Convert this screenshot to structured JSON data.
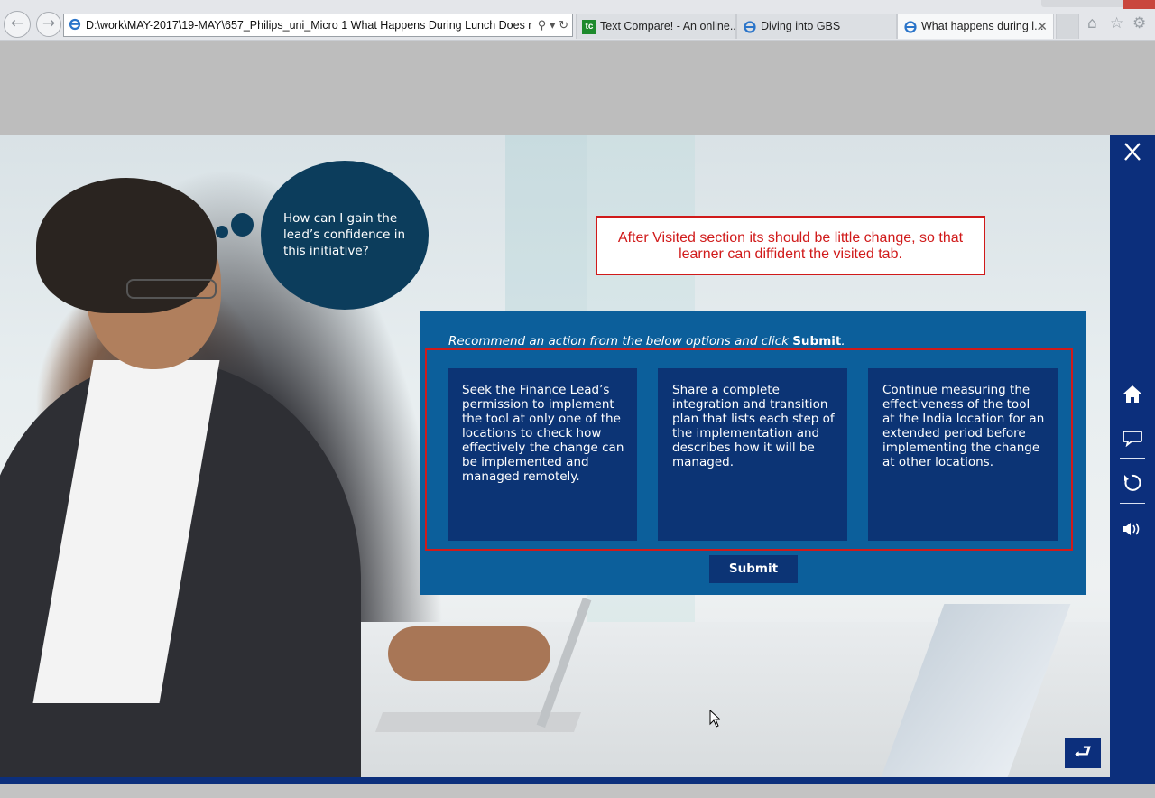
{
  "browser": {
    "address": "D:\\work\\MAY-2017\\19-MAY\\657_Philips_uni_Micro 1 What Happens During Lunch Does no",
    "tabs": [
      {
        "label": "Text Compare! - An online...",
        "icon": "tc"
      },
      {
        "label": "Diving into GBS",
        "icon": "ie"
      },
      {
        "label": "What happens during l...",
        "icon": "ie",
        "active": true
      }
    ],
    "tab_icon_text": "tc"
  },
  "scene": {
    "thought_bubble": "How can I gain the lead’s confidence in this initiative?"
  },
  "review_note": "After Visited section its should be little change, so that learner can diffident the visited tab.",
  "activity": {
    "instruction": "Recommend an action from the below options and click",
    "instruction_bold": "Submit",
    "instruction_end": ".",
    "options": [
      "Seek the Finance Lead’s permission to implement the tool at only one of the locations to check how effectively the change can be implemented and managed remotely.",
      "Share a complete integration and transition plan that lists each step of the implementation and describes how it will be managed.",
      "Continue measuring the effectiveness of the tool at the India location for an extended period before implementing the change at other locations."
    ],
    "submit_label": "Submit"
  },
  "sidebar": {
    "icons": [
      "close-icon",
      "home-icon",
      "comment-icon",
      "replay-icon",
      "volume-icon"
    ]
  },
  "colors": {
    "panel": "#0c5f9b",
    "option_card": "#0c3475",
    "sidebar": "#0c2f7c",
    "bubble": "#0c3d5c",
    "review_red": "#d01a1a"
  }
}
